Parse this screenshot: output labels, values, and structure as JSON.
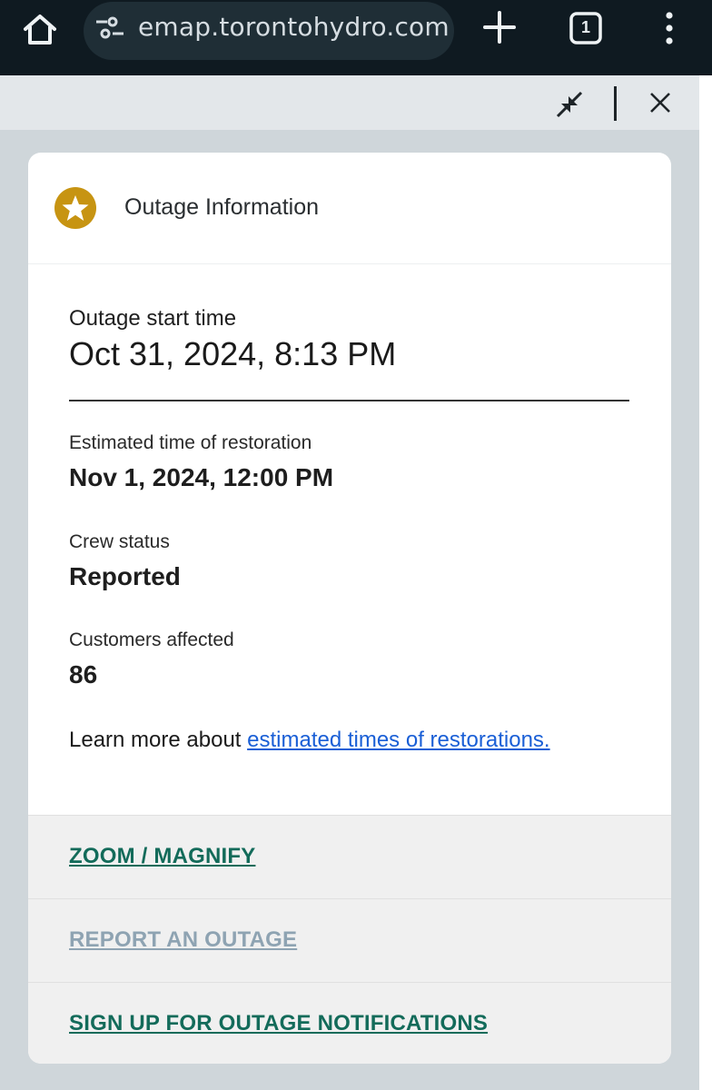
{
  "browser": {
    "url": "emap.torontohydro.com",
    "tab_count": "1",
    "icons": {
      "home": "home-icon",
      "site_settings": "tune-icon",
      "new_tab": "plus-icon",
      "tabs": "tab-switcher-icon",
      "menu": "vertical-dots-icon"
    }
  },
  "panel": {
    "icons": {
      "minimize": "collapse-arrows-icon",
      "close": "close-icon"
    }
  },
  "card": {
    "title": "Outage Information",
    "icon": "star-circle-icon",
    "start_label": "Outage start time",
    "start_value": "Oct 31, 2024, 8:13 PM",
    "etr_label": "Estimated time of restoration",
    "etr_value": "Nov 1, 2024, 12:00 PM",
    "crew_label": "Crew status",
    "crew_value": "Reported",
    "customers_label": "Customers affected",
    "customers_value": "86",
    "learn_more_text": "Learn more about ",
    "learn_more_link": "estimated times of restorations."
  },
  "actions": {
    "zoom": "ZOOM / MAGNIFY",
    "report": "REPORT AN OUTAGE",
    "signup": "SIGN UP FOR OUTAGE NOTIFICATIONS"
  },
  "colors": {
    "topbar": "#0f1a21",
    "panel": "#cfd6da",
    "accent_gold": "#c79412",
    "link_blue": "#1a5fd6",
    "action_green": "#136b5a",
    "action_muted": "#8ea3b2"
  }
}
